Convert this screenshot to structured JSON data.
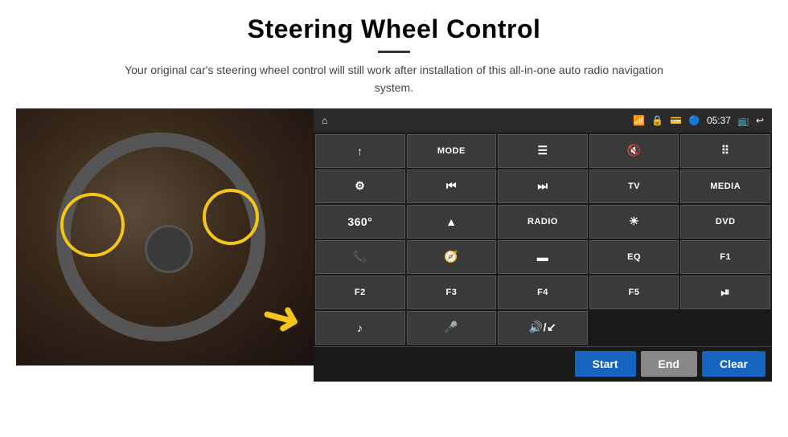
{
  "header": {
    "title": "Steering Wheel Control",
    "subtitle": "Your original car's steering wheel control will still work after installation of this all-in-one auto radio navigation system."
  },
  "statusBar": {
    "time": "05:37",
    "icons": [
      "home",
      "wifi",
      "lock",
      "sd",
      "bluetooth",
      "cast",
      "back"
    ]
  },
  "buttons": [
    {
      "label": "↑",
      "icon": true,
      "row": 1,
      "col": 1
    },
    {
      "label": "MODE",
      "row": 1,
      "col": 2
    },
    {
      "label": "≡",
      "icon": true,
      "row": 1,
      "col": 3
    },
    {
      "label": "🔇",
      "icon": true,
      "row": 1,
      "col": 4
    },
    {
      "label": "⠿",
      "icon": true,
      "row": 1,
      "col": 5
    },
    {
      "label": "⚙",
      "icon": true,
      "row": 2,
      "col": 1
    },
    {
      "label": "⏮",
      "icon": true,
      "row": 2,
      "col": 2
    },
    {
      "label": "⏭",
      "icon": true,
      "row": 2,
      "col": 3
    },
    {
      "label": "TV",
      "row": 2,
      "col": 4
    },
    {
      "label": "MEDIA",
      "row": 2,
      "col": 5
    },
    {
      "label": "360°",
      "icon": true,
      "row": 3,
      "col": 1
    },
    {
      "label": "▲",
      "icon": true,
      "row": 3,
      "col": 2
    },
    {
      "label": "RADIO",
      "row": 3,
      "col": 3
    },
    {
      "label": "☀",
      "icon": true,
      "row": 3,
      "col": 4
    },
    {
      "label": "DVD",
      "row": 3,
      "col": 5
    },
    {
      "label": "📞",
      "icon": true,
      "row": 4,
      "col": 1
    },
    {
      "label": "🌀",
      "icon": true,
      "row": 4,
      "col": 2
    },
    {
      "label": "▬",
      "icon": true,
      "row": 4,
      "col": 3
    },
    {
      "label": "EQ",
      "row": 4,
      "col": 4
    },
    {
      "label": "F1",
      "row": 4,
      "col": 5
    },
    {
      "label": "F2",
      "row": 5,
      "col": 1
    },
    {
      "label": "F3",
      "row": 5,
      "col": 2
    },
    {
      "label": "F4",
      "row": 5,
      "col": 3
    },
    {
      "label": "F5",
      "row": 5,
      "col": 4
    },
    {
      "label": "⏯",
      "icon": true,
      "row": 5,
      "col": 5
    },
    {
      "label": "♪",
      "icon": true,
      "row": 6,
      "col": 1
    },
    {
      "label": "🎤",
      "icon": true,
      "row": 6,
      "col": 2
    },
    {
      "label": "🔊/↙",
      "icon": true,
      "row": 6,
      "col": 3
    }
  ],
  "actionBar": {
    "startLabel": "Start",
    "endLabel": "End",
    "clearLabel": "Clear"
  }
}
